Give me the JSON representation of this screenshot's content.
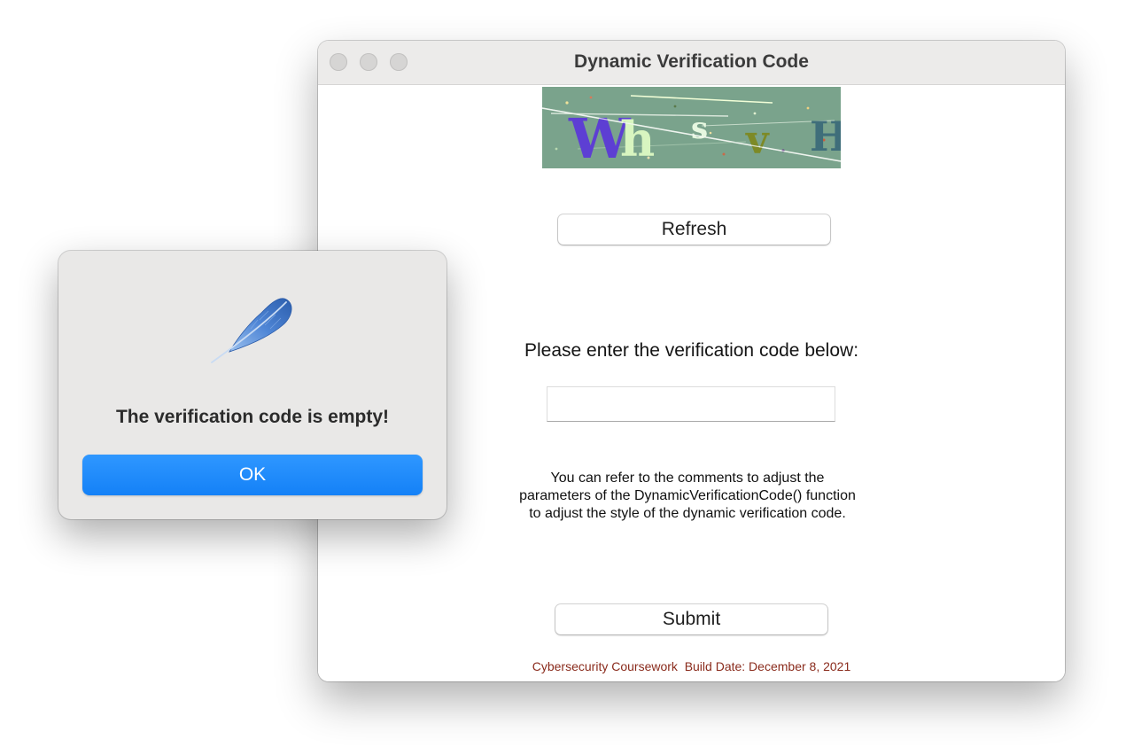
{
  "window": {
    "title": "Dynamic Verification Code",
    "traffic_lights": [
      "close",
      "minimize",
      "zoom"
    ]
  },
  "captcha": {
    "text": "WhsvH",
    "characters": [
      {
        "char": "W",
        "color": "#5d3fd3"
      },
      {
        "char": "h",
        "color": "#d8f5c0"
      },
      {
        "char": "s",
        "color": "#e6f7e0"
      },
      {
        "char": "v",
        "color": "#7d8a26"
      },
      {
        "char": "H",
        "color": "#3f6e7a"
      }
    ],
    "background_color": "#7aa38c"
  },
  "main": {
    "refresh_label": "Refresh",
    "prompt_label": "Please enter the verification code below:",
    "input_value": "",
    "input_placeholder": "",
    "hint_text": "You can refer to the comments to adjust the parameters of the DynamicVerificationCode() function to adjust the style of the dynamic verification code.",
    "submit_label": "Submit",
    "footer_text": "Cybersecurity Coursework  Build Date: December 8, 2021",
    "footer_color": "#8a2b1c"
  },
  "alert": {
    "icon": "feather-icon",
    "message": "The verification code is empty!",
    "ok_label": "OK",
    "ok_color": "#1a8cff"
  }
}
